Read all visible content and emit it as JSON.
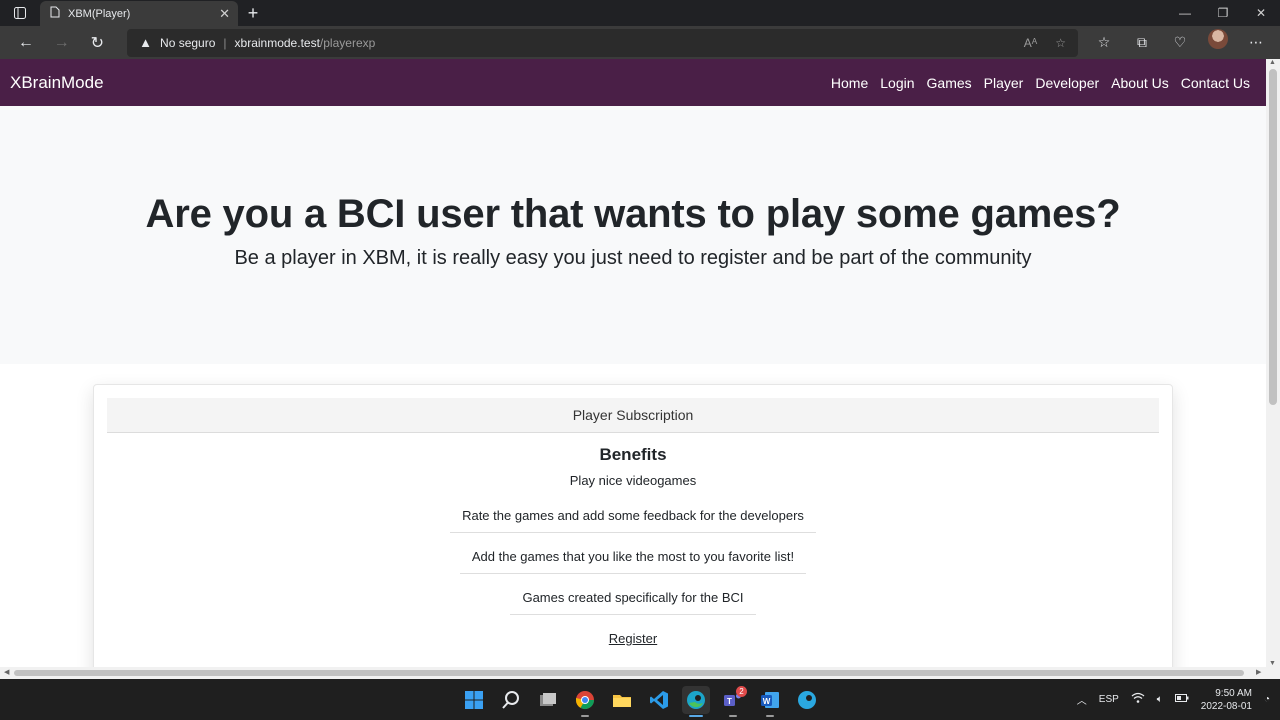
{
  "browser": {
    "tab_title": "XBM(Player)",
    "security_label": "No seguro",
    "url_host": "xbrainmode.test",
    "url_path": "/playerexp"
  },
  "site": {
    "brand": "XBrainMode",
    "menu": [
      "Home",
      "Login",
      "Games",
      "Player",
      "Developer",
      "About Us",
      "Contact Us"
    ]
  },
  "hero": {
    "title": "Are you a BCI user that wants to play some games?",
    "subtitle": "Be a player in XBM, it is really easy you just need to register and be part of the community"
  },
  "subscription": {
    "header": "Player Subscription",
    "heading": "Benefits",
    "intro": "Play nice videogames",
    "benefits": [
      "Rate the games and add some feedback for the developers",
      "Add the games that you like the most to you favorite list!",
      "Games created specifically for the BCI"
    ],
    "register_label": "Register"
  },
  "taskbar": {
    "teams_badge": "2",
    "language": "ESP",
    "time": "9:50 AM",
    "date": "2022-08-01"
  },
  "colors": {
    "navbar": "#4a1f47",
    "hero_bg": "#f8f9fa",
    "text": "#212529"
  }
}
